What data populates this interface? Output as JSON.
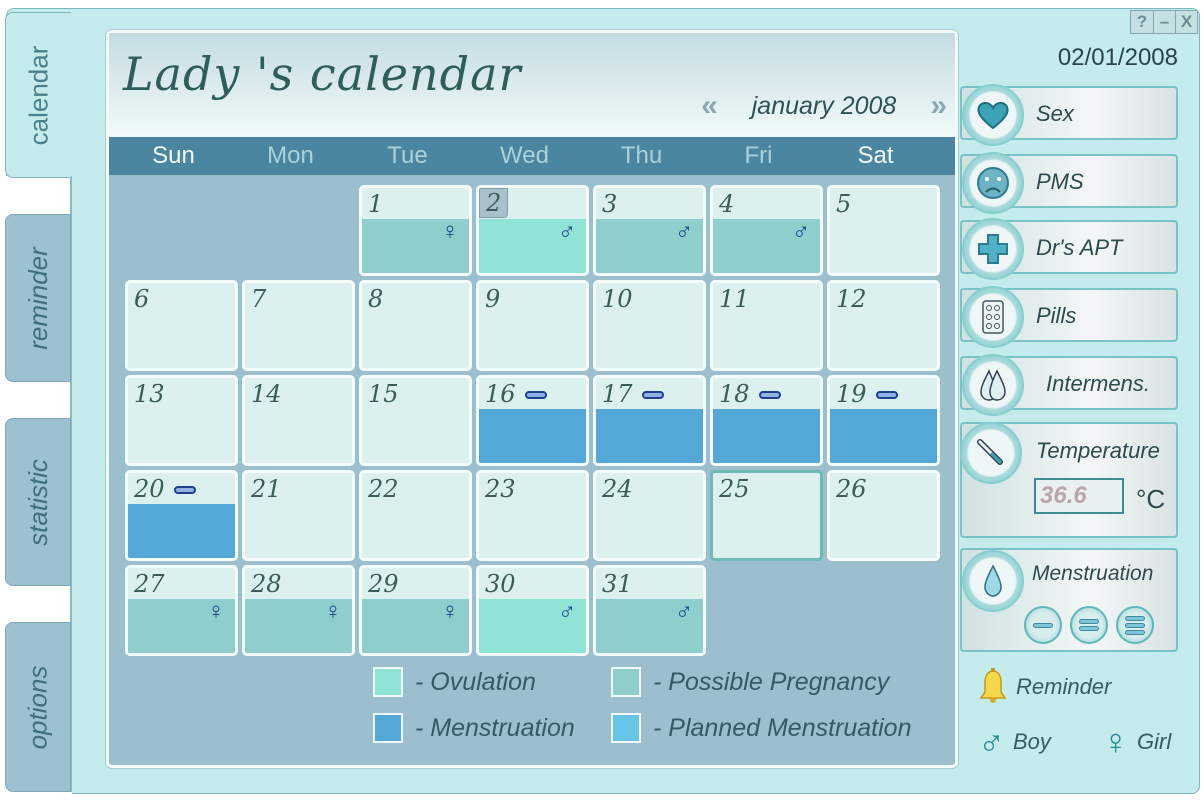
{
  "window_controls": {
    "help": "?",
    "minimize": "–",
    "close": "X"
  },
  "side_tabs": [
    {
      "label": "calendar",
      "active": true
    },
    {
      "label": "reminder",
      "active": false
    },
    {
      "label": "statistic",
      "active": false
    },
    {
      "label": "options",
      "active": false
    }
  ],
  "header": {
    "title": "Lady 's  calendar",
    "prev_icon": "double-chevron-left",
    "prev_glyph": "«",
    "month": "january 2008",
    "next_icon": "double-chevron-right",
    "next_glyph": "»"
  },
  "weekdays": [
    "Sun",
    "Mon",
    "Tue",
    "Wed",
    "Thu",
    "Fri",
    "Sat"
  ],
  "calendar": {
    "leading_blanks": 2,
    "selected_day": 25,
    "current_day": 2,
    "days": [
      {
        "day": "1",
        "type": "possible",
        "gender": "♀"
      },
      {
        "day": "2",
        "type": "ovulation",
        "gender": "♂"
      },
      {
        "day": "3",
        "type": "possible",
        "gender": "♂"
      },
      {
        "day": "4",
        "type": "possible",
        "gender": "♂"
      },
      {
        "day": "5"
      },
      {
        "day": "6"
      },
      {
        "day": "7"
      },
      {
        "day": "8"
      },
      {
        "day": "9"
      },
      {
        "day": "10"
      },
      {
        "day": "11"
      },
      {
        "day": "12"
      },
      {
        "day": "13"
      },
      {
        "day": "14"
      },
      {
        "day": "15"
      },
      {
        "day": "16",
        "type": "menstruation",
        "flow": 1
      },
      {
        "day": "17",
        "type": "menstruation",
        "flow": 1
      },
      {
        "day": "18",
        "type": "menstruation",
        "flow": 1
      },
      {
        "day": "19",
        "type": "menstruation",
        "flow": 1
      },
      {
        "day": "20",
        "type": "menstruation",
        "flow": 1
      },
      {
        "day": "21"
      },
      {
        "day": "22"
      },
      {
        "day": "23"
      },
      {
        "day": "24"
      },
      {
        "day": "25"
      },
      {
        "day": "26"
      },
      {
        "day": "27",
        "type": "possible",
        "gender": "♀"
      },
      {
        "day": "28",
        "type": "possible",
        "gender": "♀"
      },
      {
        "day": "29",
        "type": "possible",
        "gender": "♀"
      },
      {
        "day": "30",
        "type": "ovulation",
        "gender": "♂"
      },
      {
        "day": "31",
        "type": "possible",
        "gender": "♂"
      }
    ]
  },
  "legend": [
    {
      "label": "- Ovulation",
      "color": "#8fe4d6"
    },
    {
      "label": "- Possible Pregnancy",
      "color": "#8ecfce"
    },
    {
      "label": "- Menstruation",
      "color": "#54a8d8"
    },
    {
      "label": "- Planned Menstruation",
      "color": "#66c6e8"
    }
  ],
  "right_panel": {
    "date": "02/01/2008",
    "buttons": [
      {
        "label": "Sex",
        "icon": "heart-icon"
      },
      {
        "label": "PMS",
        "icon": "sad-face-icon"
      },
      {
        "label": "Dr's APT",
        "icon": "medical-cross-icon"
      },
      {
        "label": "Pills",
        "icon": "pill-pack-icon"
      },
      {
        "label": "Intermens.",
        "icon": "drops-icon"
      }
    ],
    "temperature": {
      "label": "Temperature",
      "value": "36.6",
      "unit": "°C"
    },
    "menstruation": {
      "label": "Menstruation",
      "levels": [
        "light",
        "medium",
        "heavy"
      ]
    },
    "reminder_label": "Reminder",
    "boy": {
      "glyph": "♂",
      "label": "Boy"
    },
    "girl": {
      "glyph": "♀",
      "label": "Girl"
    }
  }
}
